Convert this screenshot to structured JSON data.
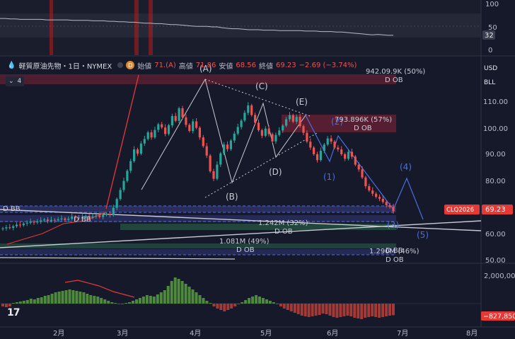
{
  "header": {
    "drop_icon": "drop-icon",
    "symbol_title": "軽質原油先物・1日・NYMEX",
    "badge": "D",
    "open_label": "始値",
    "open_value": "71.(A)",
    "high_label": "高値",
    "high_value": "71.86",
    "low_label": "安値",
    "low_value": "68.56",
    "close_label": "終値",
    "close_value": "69.23",
    "change": "−2.69 (−3.74%)",
    "indicator_count": "4"
  },
  "currency": {
    "line1": "USD",
    "line2": "BLL"
  },
  "colors": {
    "background": "#16192a",
    "up": "#26a69a",
    "down": "#ef5350",
    "accent_blue": "#3b6fd8",
    "price_tag": "#e53935",
    "wave_white": "#d6d8e0",
    "wave_blue": "#4a6ee0"
  },
  "chart_data": [
    {
      "type": "line",
      "name": "oscillator",
      "yticks": [
        "100",
        "50",
        "0"
      ],
      "ylim": [
        0,
        100
      ],
      "last_value": "32",
      "values": [
        68,
        68,
        67,
        67,
        66,
        66,
        66,
        66,
        66,
        65,
        65,
        65,
        65,
        65,
        64,
        64,
        64,
        64,
        63,
        63,
        63,
        62,
        62,
        61,
        61,
        60,
        60,
        59,
        58,
        58,
        57,
        57,
        56,
        55,
        55,
        54,
        53,
        52,
        51,
        51,
        51,
        50,
        50,
        48,
        47,
        46,
        46,
        45,
        44,
        44,
        44,
        43,
        43,
        43,
        42,
        42,
        42,
        42,
        42,
        41,
        41,
        41,
        40,
        40,
        40,
        39,
        39,
        38,
        37,
        36,
        35,
        34,
        33,
        34,
        33,
        32,
        32
      ]
    },
    {
      "type": "candlestick",
      "name": "軽質原油先物",
      "xlabels": [
        "2月",
        "3月",
        "4月",
        "5月",
        "6月",
        "7月",
        "8月"
      ],
      "yticks": [
        "110.00",
        "100.00",
        "90.00",
        "80.00",
        "70.00",
        "60.00",
        "50.00"
      ],
      "ylim": [
        50,
        120
      ],
      "last_price": "69.23",
      "last_price_label": "CLQ2026",
      "closes": [
        62.8,
        63.2,
        63.0,
        63.6,
        64.2,
        64.0,
        64.6,
        64.9,
        65.3,
        65.0,
        65.4,
        65.8,
        66.1,
        65.6,
        66.0,
        65.8,
        66.2,
        66.5,
        66.0,
        66.4,
        67.2,
        66.9,
        66.6,
        67.0,
        67.4,
        66.8,
        67.3,
        67.6,
        67.1,
        67.9,
        68.3,
        67.8,
        70.5,
        73.8,
        77.2,
        80.6,
        84.4,
        88.0,
        92.4,
        90.8,
        94.6,
        96.3,
        98.8,
        96.9,
        99.7,
        101.8,
        100.6,
        98.2,
        101.4,
        104.9,
        103.1,
        107.8,
        104.4,
        101.6,
        99.3,
        102.9,
        100.5,
        96.9,
        93.6,
        90.1,
        84.2,
        81.4,
        86.7,
        90.9,
        94.2,
        92.5,
        95.7,
        98.3,
        100.8,
        103.2,
        106.1,
        108.9,
        105.3,
        102.4,
        99.6,
        97.5,
        100.2,
        98.1,
        95.4,
        97.8,
        99.5,
        101.3,
        103.7,
        105.2,
        102.8,
        104.6,
        101.1,
        98.6,
        95.3,
        93.1,
        90.6,
        88.4,
        91.9,
        94.2,
        96.5,
        95.3,
        93.1,
        92.4,
        90.6,
        88.9,
        91.5,
        89.7,
        86.7,
        84.9,
        81.9,
        78.6,
        77.0,
        75.8,
        74.6,
        73.9,
        72.7,
        71.5,
        70.8,
        69.23
      ],
      "waves_white": [
        "(A)",
        "(B)",
        "(C)",
        "(D)",
        "(E)"
      ],
      "waves_blue": [
        "(1)",
        "(2)",
        "(3)",
        "(4)",
        "(5)"
      ],
      "zones": [
        {
          "text": "942.09.9K (50%)",
          "sub": "D OB"
        },
        {
          "text": "793.896K (57%)",
          "sub": "D OB"
        },
        {
          "text": "1.242M (32%)",
          "sub": "D OB"
        },
        {
          "text": "1.081M (49%)",
          "sub": "D OB"
        },
        {
          "text": "1.290M (46%)",
          "sub": "D OB"
        }
      ],
      "bb_labels": [
        "D BB",
        "D BB",
        "D BB"
      ]
    },
    {
      "type": "bar",
      "name": "volume_histogram",
      "yticks": [
        "2,000,000"
      ],
      "last_value": "−827,850",
      "values": [
        -0.2,
        -0.25,
        -0.2,
        0.05,
        0.1,
        0.15,
        0.2,
        0.25,
        0.35,
        0.3,
        0.4,
        0.45,
        0.55,
        0.6,
        0.7,
        0.8,
        0.85,
        0.9,
        0.95,
        1.0,
        0.95,
        0.9,
        0.85,
        0.8,
        0.7,
        0.6,
        0.55,
        0.5,
        0.4,
        0.3,
        0.2,
        0.1,
        0.05,
        0.0,
        -0.05,
        0.05,
        0.1,
        0.2,
        0.3,
        0.4,
        0.5,
        0.6,
        0.55,
        0.5,
        0.65,
        0.8,
        0.95,
        1.25,
        1.6,
        1.85,
        1.75,
        1.6,
        1.4,
        1.2,
        1.0,
        0.8,
        0.6,
        0.4,
        0.2,
        0.05,
        -0.2,
        -0.35,
        -0.45,
        -0.55,
        -0.45,
        -0.35,
        -0.2,
        -0.05,
        0.1,
        0.25,
        0.4,
        0.5,
        0.6,
        0.5,
        0.4,
        0.3,
        0.2,
        0.1,
        -0.05,
        -0.2,
        -0.35,
        -0.45,
        -0.55,
        -0.65,
        -0.75,
        -0.85,
        -0.9,
        -0.95,
        -0.9,
        -0.85,
        -0.8,
        -0.7,
        -0.75,
        -0.85,
        -0.95,
        -1.0,
        -0.95,
        -0.9,
        -0.85,
        -0.9,
        -1.0,
        -1.05,
        -1.1,
        -1.0,
        -0.95,
        -0.9,
        -0.95,
        -1.0,
        -0.95,
        -0.9,
        -0.85,
        -0.82
      ]
    }
  ]
}
